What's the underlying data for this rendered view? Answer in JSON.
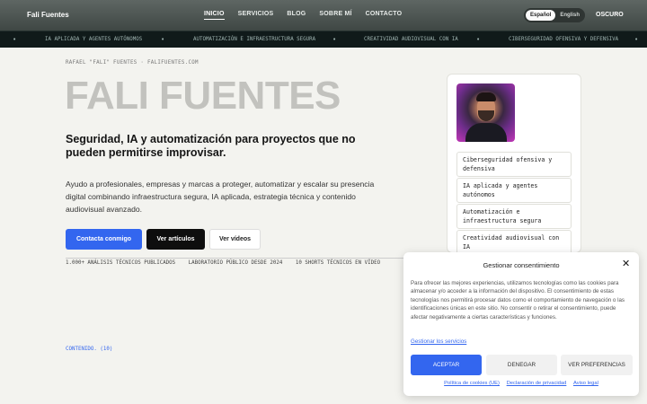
{
  "header": {
    "brand": "Fali Fuentes",
    "nav": [
      "INICIO",
      "SERVICIOS",
      "BLOG",
      "SOBRE MÍ",
      "CONTACTO"
    ],
    "lang_es": "Español",
    "lang_en": "English",
    "theme": "OSCURO"
  },
  "ticker": [
    "IA APLICADA Y AGENTES AUTÓNOMOS",
    "AUTOMATIZACIÓN E INFRAESTRUCTURA SEGURA",
    "CREATIVIDAD AUDIOVISUAL CON IA",
    "CIBERSEGURIDAD OFENSIVA Y DEFENSIVA"
  ],
  "hero": {
    "kicker": "RAFAEL \"FALI\" FUENTES · FALIFUENTES.COM",
    "title": "FALI FUENTES",
    "subtitle": "Seguridad, IA y automatización para proyectos que no pueden permitirse improvisar.",
    "description": "Ayudo a profesionales, empresas y marcas a proteger, automatizar y escalar su presencia digital combinando infraestructura segura, IA aplicada, estrategia técnica y contenido audiovisual avanzado.",
    "btn_contact": "Contacta conmigo",
    "btn_articles": "Ver artículos",
    "btn_videos": "Ver vídeos",
    "stats": [
      "1.000+ ANÁLISIS TÉCNICOS PUBLICADOS",
      "LABORATORIO PÚBLICO DESDE 2024",
      "10 SHORTS TÉCNICOS EN VÍDEO"
    ],
    "content_count": "CONTENIDO. (10)"
  },
  "card": {
    "tags": [
      "Ciberseguridad ofensiva y defensiva",
      "IA aplicada y agentes autónomos",
      "Automatización e infraestructura segura",
      "Creatividad audiovisual con IA"
    ]
  },
  "consent": {
    "title": "Gestionar consentimiento",
    "text": "Para ofrecer las mejores experiencias, utilizamos tecnologías como las cookies para almacenar y/o acceder a la información del dispositivo. El consentimiento de estas tecnologías nos permitirá procesar datos como el comportamiento de navegación o las identificaciones únicas en este sitio. No consentir o retirar el consentimiento, puede afectar negativamente a ciertas características y funciones.",
    "manage": "Gestionar los servicios",
    "accept": "ACEPTAR",
    "deny": "DENEGAR",
    "prefs": "VER PREFERENCIAS",
    "links": [
      "Política de cookies (UE)",
      "Declaración de privacidad",
      "Aviso legal"
    ]
  },
  "colors": {
    "accent": "#3366ef",
    "header_bg": "#4b5350",
    "ticker_bg": "#101a1a"
  }
}
